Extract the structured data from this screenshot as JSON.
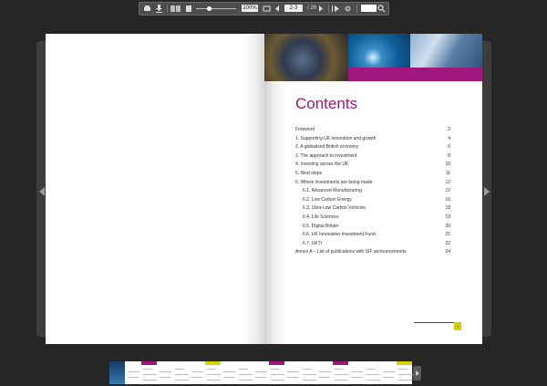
{
  "toolbar": {
    "zoom": "100%",
    "page_current": "2-3",
    "page_total": "/ 26",
    "icons": [
      "print-icon",
      "download-icon",
      "layout-icon",
      "single-page-icon",
      "slider",
      "fullscreen-icon",
      "prev-page-icon",
      "next-page-icon",
      "autoplay-icon",
      "settings-icon",
      "search-icon"
    ]
  },
  "page": {
    "contents_title": "Contents",
    "toc": [
      {
        "label": "Foreword",
        "page": "3",
        "sub": false
      },
      {
        "label": "1.   Supporting UK innovation and growth",
        "page": "4",
        "sub": false
      },
      {
        "label": "2.   A globalized British economy",
        "page": "6",
        "sub": false
      },
      {
        "label": "3.   The approach to investment",
        "page": "8",
        "sub": false
      },
      {
        "label": "4.   Investing across the UK",
        "page": "10",
        "sub": false
      },
      {
        "label": "5.   Next steps",
        "page": "11",
        "sub": false
      },
      {
        "label": "6.   Where investments are being made",
        "page": "12",
        "sub": false
      },
      {
        "label": "6.1. Advanced Manufacturing",
        "page": "12",
        "sub": true
      },
      {
        "label": "6.2. Low Carbon Energy",
        "page": "16",
        "sub": true
      },
      {
        "label": "6.3. Ultra-Low Carbon Vehicles",
        "page": "18",
        "sub": true
      },
      {
        "label": "6.4. Life Sciences",
        "page": "19",
        "sub": true
      },
      {
        "label": "6.5. Digital Britain",
        "page": "20",
        "sub": true
      },
      {
        "label": "6.6. UK Innovation Investment Fund",
        "page": "21",
        "sub": true
      },
      {
        "label": "6.7. UKTI",
        "page": "22",
        "sub": true
      },
      {
        "label": "Annex A – List of publications with SIF announcements",
        "page": "24",
        "sub": false
      }
    ],
    "page_number": "1"
  },
  "colors": {
    "accent": "#a0177e",
    "background": "#262626",
    "badge": "#d8d200"
  }
}
